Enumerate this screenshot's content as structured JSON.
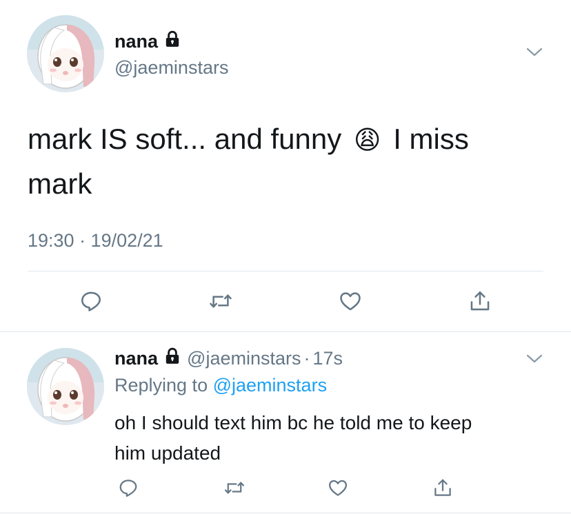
{
  "tweet": {
    "author_name": "nana",
    "author_handle": "@jaeminstars",
    "text_part1": "mark IS soft... and funny",
    "emoji": "😩",
    "text_part2": "I miss",
    "text_line2": "mark",
    "timestamp": "19:30 · 19/02/21",
    "actions": [
      "reply-icon",
      "retweet-icon",
      "like-icon",
      "share-icon"
    ]
  },
  "reply": {
    "author_name": "nana",
    "author_handle": "@jaeminstars",
    "separator": "·",
    "age": "17s",
    "replying_prefix": "Replying to",
    "replying_to": "@jaeminstars",
    "text_line1": "oh I should text him bc he told me to keep",
    "text_line2": "him updated",
    "actions": [
      "reply-icon",
      "retweet-icon",
      "like-icon",
      "share-icon"
    ]
  },
  "colors": {
    "text": "#14171a",
    "secondary": "#657786",
    "link": "#1da1f2",
    "divider": "#e1e8ed"
  }
}
